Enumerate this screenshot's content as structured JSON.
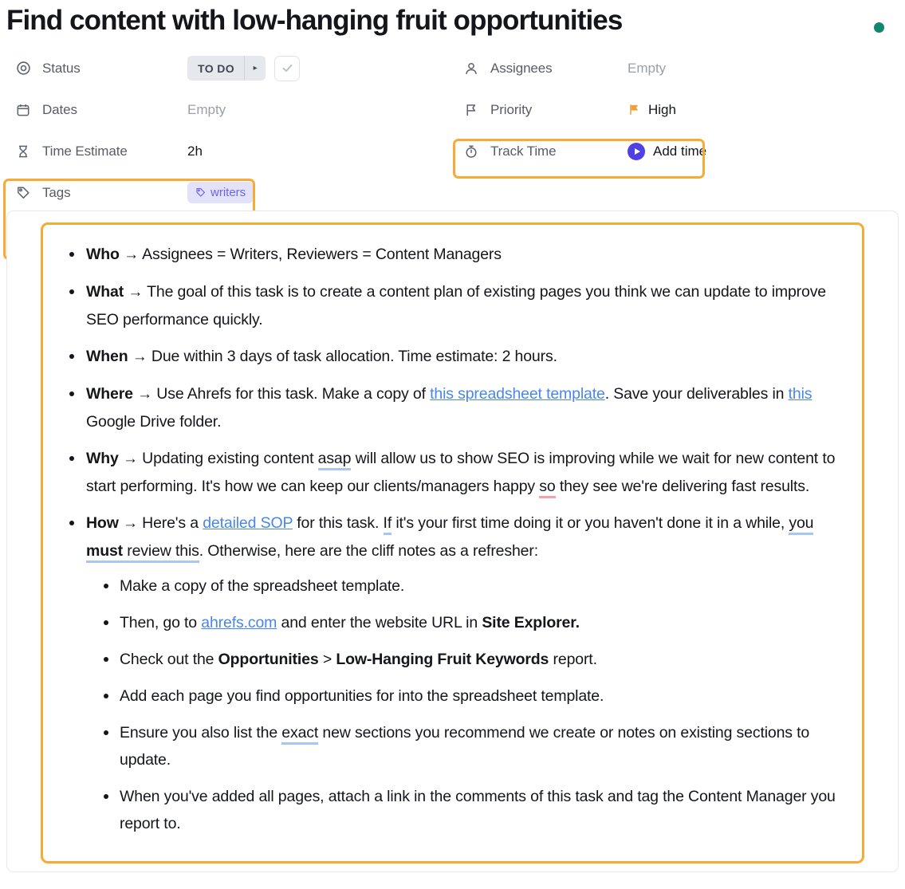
{
  "header": {
    "title": "Find content with low-hanging fruit opportunities",
    "status_dot_color": "#13866f",
    "status_dot_name": "online-indicator"
  },
  "meta": {
    "left": [
      {
        "icon": "target-icon",
        "label": "Status",
        "value_type": "status-pill",
        "value": "TO DO",
        "caret": "▸",
        "check": "✓"
      },
      {
        "icon": "calendar-icon",
        "label": "Dates",
        "value_type": "empty",
        "value": "Empty"
      },
      {
        "icon": "hourglass-icon",
        "label": "Time Estimate",
        "value_type": "text",
        "value": "2h"
      },
      {
        "icon": "tag-icon",
        "label": "Tags",
        "value_type": "tag-chip",
        "value": "writers"
      }
    ],
    "right": [
      {
        "icon": "person-icon",
        "label": "Assignees",
        "value_type": "empty",
        "value": "Empty"
      },
      {
        "icon": "flag-icon",
        "label": "Priority",
        "value_type": "priority",
        "value": "High"
      },
      {
        "icon": "stopwatch-icon",
        "label": "Track Time",
        "value_type": "add-time",
        "value": "Add time"
      }
    ]
  },
  "highlights": {
    "left_box_color": "#f5ab35",
    "priority_box_color": "#f5ab35",
    "description_box_color": "#f5ab35"
  },
  "colors": {
    "link": "#4a86e8",
    "tag_bg": "#e3e2fb",
    "tag_text": "#6b64e8",
    "priority_flag": "#eda13b",
    "play_button": "#5041e4",
    "grammar_blue": "#a8c7f0",
    "grammar_pink": "#f5a0ad"
  },
  "description": {
    "bullets": [
      {
        "id": "who",
        "lead": "Who",
        "arrow": "→",
        "text": "Assignees = Writers, Reviewers = Content Managers"
      },
      {
        "id": "what",
        "lead": "What",
        "arrow": "→",
        "text": "The goal of this task is to create a content plan of existing pages you think we can update to improve SEO performance quickly."
      },
      {
        "id": "when",
        "lead": "When",
        "arrow": "→",
        "text": "Due within 3 days of task allocation. Time estimate: 2 hours."
      },
      {
        "id": "where",
        "lead": "Where",
        "arrow": "→",
        "t1": "Use Ahrefs for this task. Make a copy of ",
        "link1": "this spreadsheet template",
        "t2": ". Save your deliverables in ",
        "link2": "this",
        "t3": " Google Drive folder."
      },
      {
        "id": "why",
        "lead": "Why",
        "arrow": "→",
        "t1": "Updating existing content ",
        "flag1": "asap",
        "t2": " will allow us to show SEO is improving while we wait for new content to start performing. It's how we can keep our clients/managers happy ",
        "flag2": "so",
        "t3": " they see we're delivering fast results."
      },
      {
        "id": "how",
        "lead": "How",
        "arrow": "→",
        "t1": "Here's a ",
        "link1": "detailed SOP",
        "t2": " for this task. ",
        "flag1": "If",
        "t3": " it's your first time doing it or you haven't done it in a while, ",
        "flag2_pre": "you ",
        "flag2_bold": "must",
        "flag2_post": " review this",
        "t4": ". Otherwise, here are the cliff notes as a refresher:"
      }
    ],
    "sub_bullets": [
      {
        "id": "sub-copy",
        "t1": "Make a copy of the spreadsheet template."
      },
      {
        "id": "sub-ahrefs",
        "t1": "Then, go to ",
        "link1": "ahrefs.com",
        "t2": " and enter the website URL in ",
        "bold1": "Site Explorer."
      },
      {
        "id": "sub-report",
        "t1": "Check out the ",
        "bold1": "Opportunities",
        "t2": " > ",
        "bold2": "Low-Hanging Fruit Keywords",
        "t3": " report."
      },
      {
        "id": "sub-add",
        "t1": "Add each page you find opportunities for into the spreadsheet template."
      },
      {
        "id": "sub-exact",
        "t1": "Ensure you also list the ",
        "flag1": "exact",
        "t2": " new sections you recommend we create or notes on existing sections to update."
      },
      {
        "id": "sub-comment",
        "t1": "When you've added all pages, attach a link in the comments of this task and tag the Content Manager you report to."
      }
    ]
  }
}
